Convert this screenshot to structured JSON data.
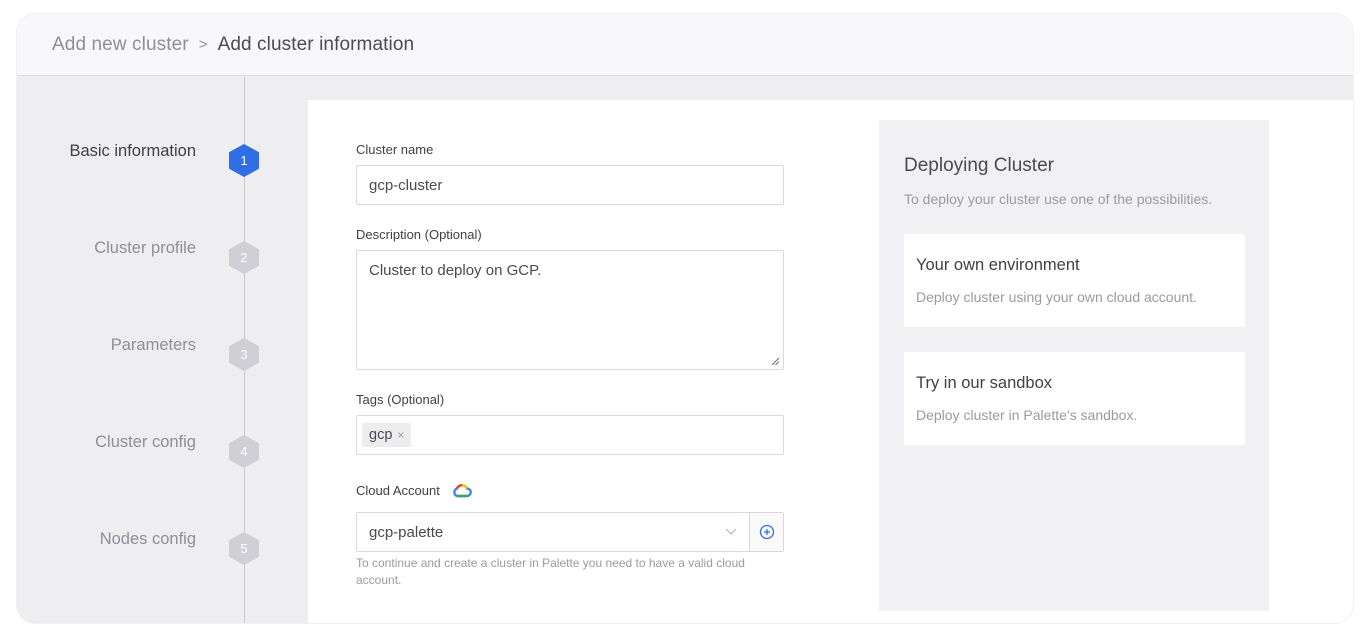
{
  "breadcrumb": {
    "root": "Add new cluster",
    "separator": ">",
    "current": "Add cluster information"
  },
  "steps": [
    {
      "label": "Basic information",
      "number": "1",
      "active": true
    },
    {
      "label": "Cluster profile",
      "number": "2",
      "active": false
    },
    {
      "label": "Parameters",
      "number": "3",
      "active": false
    },
    {
      "label": "Cluster config",
      "number": "4",
      "active": false
    },
    {
      "label": "Nodes config",
      "number": "5",
      "active": false
    }
  ],
  "form": {
    "cluster_name": {
      "label": "Cluster name",
      "value": "gcp-cluster"
    },
    "description": {
      "label": "Description (Optional)",
      "value": "Cluster to deploy on GCP."
    },
    "tags": {
      "label": "Tags (Optional)",
      "items": [
        "gcp"
      ],
      "remove_symbol": "×"
    },
    "cloud_account": {
      "label": "Cloud Account",
      "icon": "gcp-cloud-icon",
      "selected": "gcp-palette",
      "hint": "To continue and create a cluster in Palette you need to have a valid cloud account."
    }
  },
  "info_panel": {
    "title": "Deploying Cluster",
    "subtitle": "To deploy your cluster use one of the possibilities.",
    "cards": [
      {
        "title": "Your own environment",
        "description": "Deploy cluster using your own cloud account."
      },
      {
        "title": "Try in our sandbox",
        "description": "Deploy cluster in Palette's sandbox."
      }
    ]
  },
  "colors": {
    "accent": "#2f6ee5",
    "inactive_step": "#cfcfd5"
  }
}
